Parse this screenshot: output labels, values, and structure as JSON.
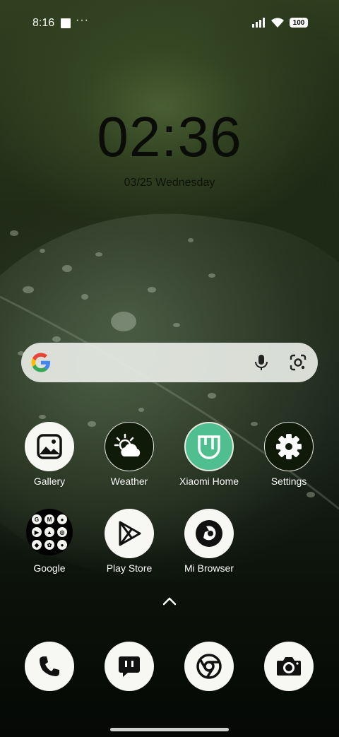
{
  "status_bar": {
    "time": "8:16",
    "more": "···",
    "battery": "100",
    "icons": [
      "notification-square-icon",
      "signal-icon",
      "wifi-icon",
      "battery-icon"
    ]
  },
  "lockscreen_clock": {
    "time": "02:36",
    "date": "03/25 Wednesday"
  },
  "search_bar": {
    "icons": [
      "google-g-icon",
      "mic-icon",
      "google-lens-icon"
    ]
  },
  "apps": [
    {
      "label": "Gallery",
      "icon": "gallery-icon"
    },
    {
      "label": "Weather",
      "icon": "weather-icon"
    },
    {
      "label": "Xiaomi Home",
      "icon": "xiaomi-home-icon"
    },
    {
      "label": "Settings",
      "icon": "gear-icon"
    },
    {
      "label": "Google",
      "icon": "google-folder-icon"
    },
    {
      "label": "Play Store",
      "icon": "play-store-icon"
    },
    {
      "label": "Mi Browser",
      "icon": "mi-browser-icon"
    }
  ],
  "google_folder_items": [
    "G",
    "M",
    "●",
    "▶",
    "▲",
    "◎",
    "◆",
    "✿",
    "●"
  ],
  "dock": [
    {
      "icon": "phone-icon"
    },
    {
      "icon": "messages-icon"
    },
    {
      "icon": "chrome-icon"
    },
    {
      "icon": "camera-icon"
    }
  ],
  "colors": {
    "icon_white": "#f7f7f3",
    "icon_dark": "#101a08",
    "xiaomi_green": "#4fbf8f"
  }
}
